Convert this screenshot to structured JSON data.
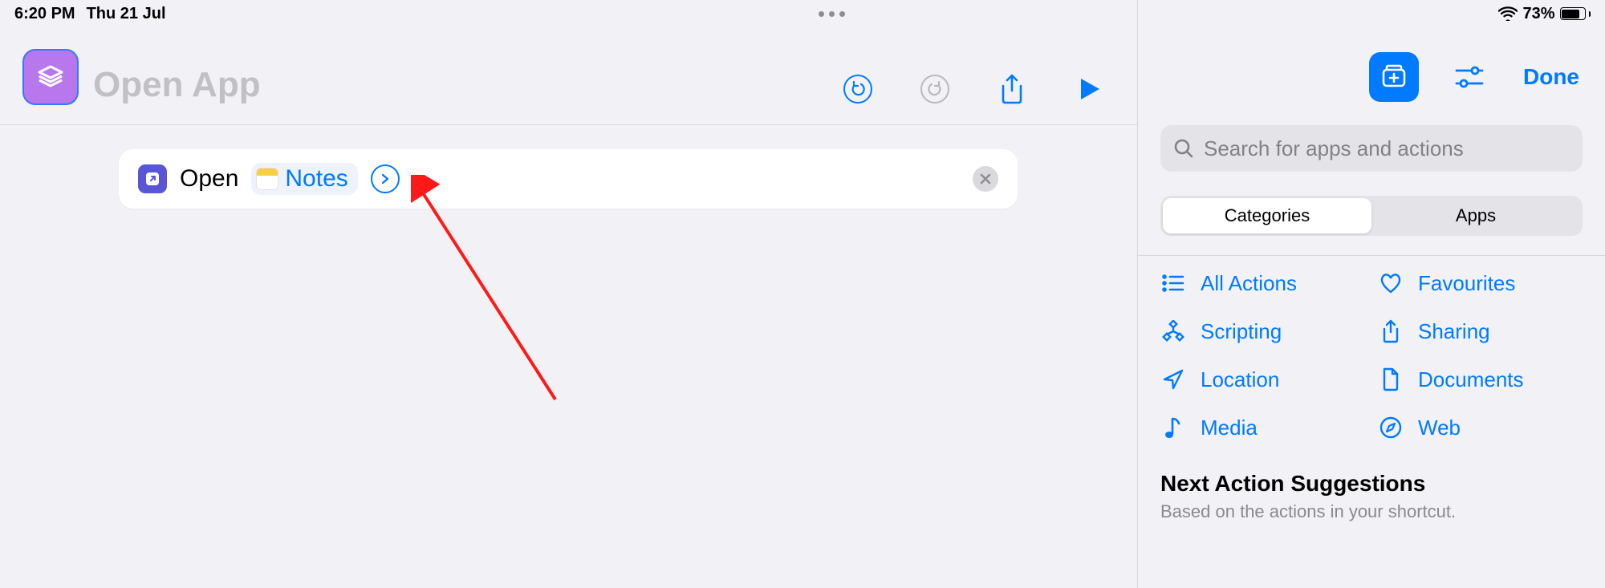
{
  "status": {
    "time": "6:20 PM",
    "date": "Thu 21 Jul",
    "battery_pct": "73%"
  },
  "header": {
    "title_placeholder": "Open App"
  },
  "action": {
    "verb": "Open",
    "param_app": "Notes"
  },
  "right": {
    "done_label": "Done",
    "search_placeholder": "Search for apps and actions",
    "segment_categories": "Categories",
    "segment_apps": "Apps"
  },
  "categories": [
    {
      "id": "all-actions",
      "label": "All Actions"
    },
    {
      "id": "favourites",
      "label": "Favourites"
    },
    {
      "id": "scripting",
      "label": "Scripting"
    },
    {
      "id": "sharing",
      "label": "Sharing"
    },
    {
      "id": "location",
      "label": "Location"
    },
    {
      "id": "documents",
      "label": "Documents"
    },
    {
      "id": "media",
      "label": "Media"
    },
    {
      "id": "web",
      "label": "Web"
    }
  ],
  "next": {
    "title": "Next Action Suggestions",
    "subtitle": "Based on the actions in your shortcut."
  }
}
